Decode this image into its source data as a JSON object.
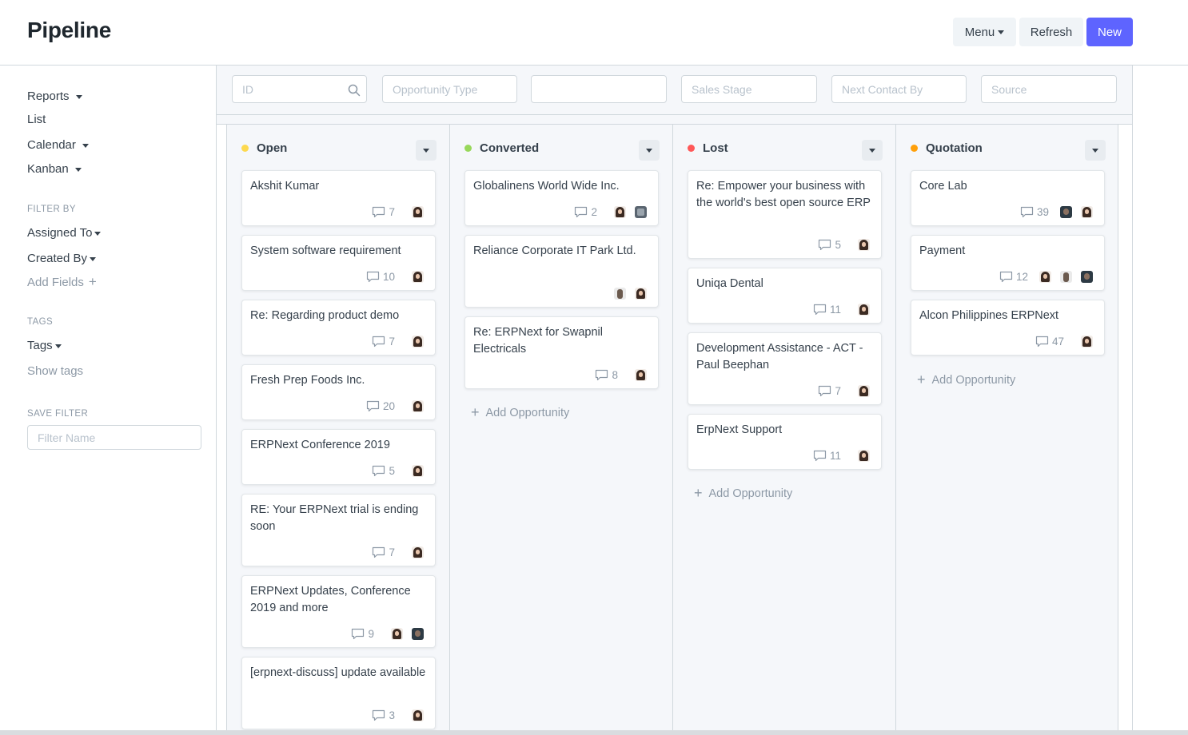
{
  "header": {
    "title": "Pipeline",
    "menu_label": "Menu",
    "refresh_label": "Refresh",
    "new_label": "New"
  },
  "sidebar": {
    "views": [
      "Reports",
      "List",
      "Calendar",
      "Kanban"
    ],
    "filter_by_heading": "FILTER BY",
    "assigned_to": "Assigned To",
    "created_by": "Created By",
    "add_fields": "Add Fields",
    "tags_heading": "TAGS",
    "tags": "Tags",
    "show_tags": "Show tags",
    "save_filter_heading": "SAVE FILTER",
    "filter_name_placeholder": "Filter Name"
  },
  "filters": {
    "id_placeholder": "ID",
    "opportunity_type_placeholder": "Opportunity Type",
    "blank_placeholder": "",
    "sales_stage_placeholder": "Sales Stage",
    "next_contact_by_placeholder": "Next Contact By",
    "source_placeholder": "Source"
  },
  "columns": [
    {
      "name": "Open",
      "color": "#fdd94f",
      "cards": [
        {
          "title": "Akshit Kumar",
          "comments": "7"
        },
        {
          "title": "System software requirement",
          "comments": "10"
        },
        {
          "title": "Re: Regarding product demo",
          "comments": "7"
        },
        {
          "title": "Fresh Prep Foods Inc.",
          "comments": "20"
        },
        {
          "title": "ERPNext Conference 2019",
          "comments": "5"
        },
        {
          "title": "RE: Your ERPNext trial is ending soon",
          "comments": "7"
        },
        {
          "title": "ERPNext Updates, Conference 2019 and more",
          "comments": "9"
        },
        {
          "title": "[erpnext-discuss] update available",
          "comments": "3"
        }
      ]
    },
    {
      "name": "Converted",
      "color": "#98d85b",
      "cards": [
        {
          "title": "Globalinens World Wide Inc.",
          "comments": "2"
        },
        {
          "title": "Reliance Corporate IT Park Ltd.",
          "comments": ""
        },
        {
          "title": "Re: ERPNext for Swapnil Electricals",
          "comments": "8"
        }
      ],
      "add_label": "Add Opportunity"
    },
    {
      "name": "Lost",
      "color": "#ff5858",
      "cards": [
        {
          "title": "Re: Empower your business with the world's best open source ERP",
          "comments": "5"
        },
        {
          "title": "Uniqa Dental",
          "comments": "11"
        },
        {
          "title": "Development Assistance - ACT - Paul Beephan",
          "comments": "7"
        },
        {
          "title": "ErpNext Support",
          "comments": "11"
        }
      ],
      "add_label": "Add Opportunity"
    },
    {
      "name": "Quotation",
      "color": "#ffa00a",
      "cards": [
        {
          "title": "Core Lab",
          "comments": "39"
        },
        {
          "title": "Payment",
          "comments": "12"
        },
        {
          "title": "Alcon Philippines ERPNext",
          "comments": "47"
        }
      ],
      "add_label": "Add Opportunity"
    }
  ],
  "icons": {
    "search": "search-icon",
    "comment": "comment-icon",
    "plus": "plus-icon",
    "caret": "caret-down-icon"
  }
}
